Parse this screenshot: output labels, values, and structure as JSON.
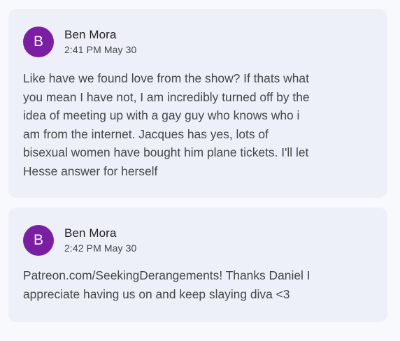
{
  "comments": [
    {
      "avatar_initial": "B",
      "author": "Ben Mora",
      "timestamp": "2:41 PM May 30",
      "body": "Like have we found love from the show? If thats what\nyou mean I have not, I am incredibly turned off by the\nidea of meeting up with a gay guy who knows who i\nam from the internet. Jacques has yes, lots of\nbisexual women have bought him plane tickets. I'll let\nHesse answer for herself"
    },
    {
      "avatar_initial": "B",
      "author": "Ben Mora",
      "timestamp": "2:42 PM May 30",
      "body": "Patreon.com/SeekingDerangements! Thanks Daniel I\nappreciate having us on and keep slaying diva <3"
    }
  ],
  "colors": {
    "avatar_background": "#7b1fa2",
    "card_background": "#edf0f9",
    "page_background": "#f8f9fc"
  }
}
